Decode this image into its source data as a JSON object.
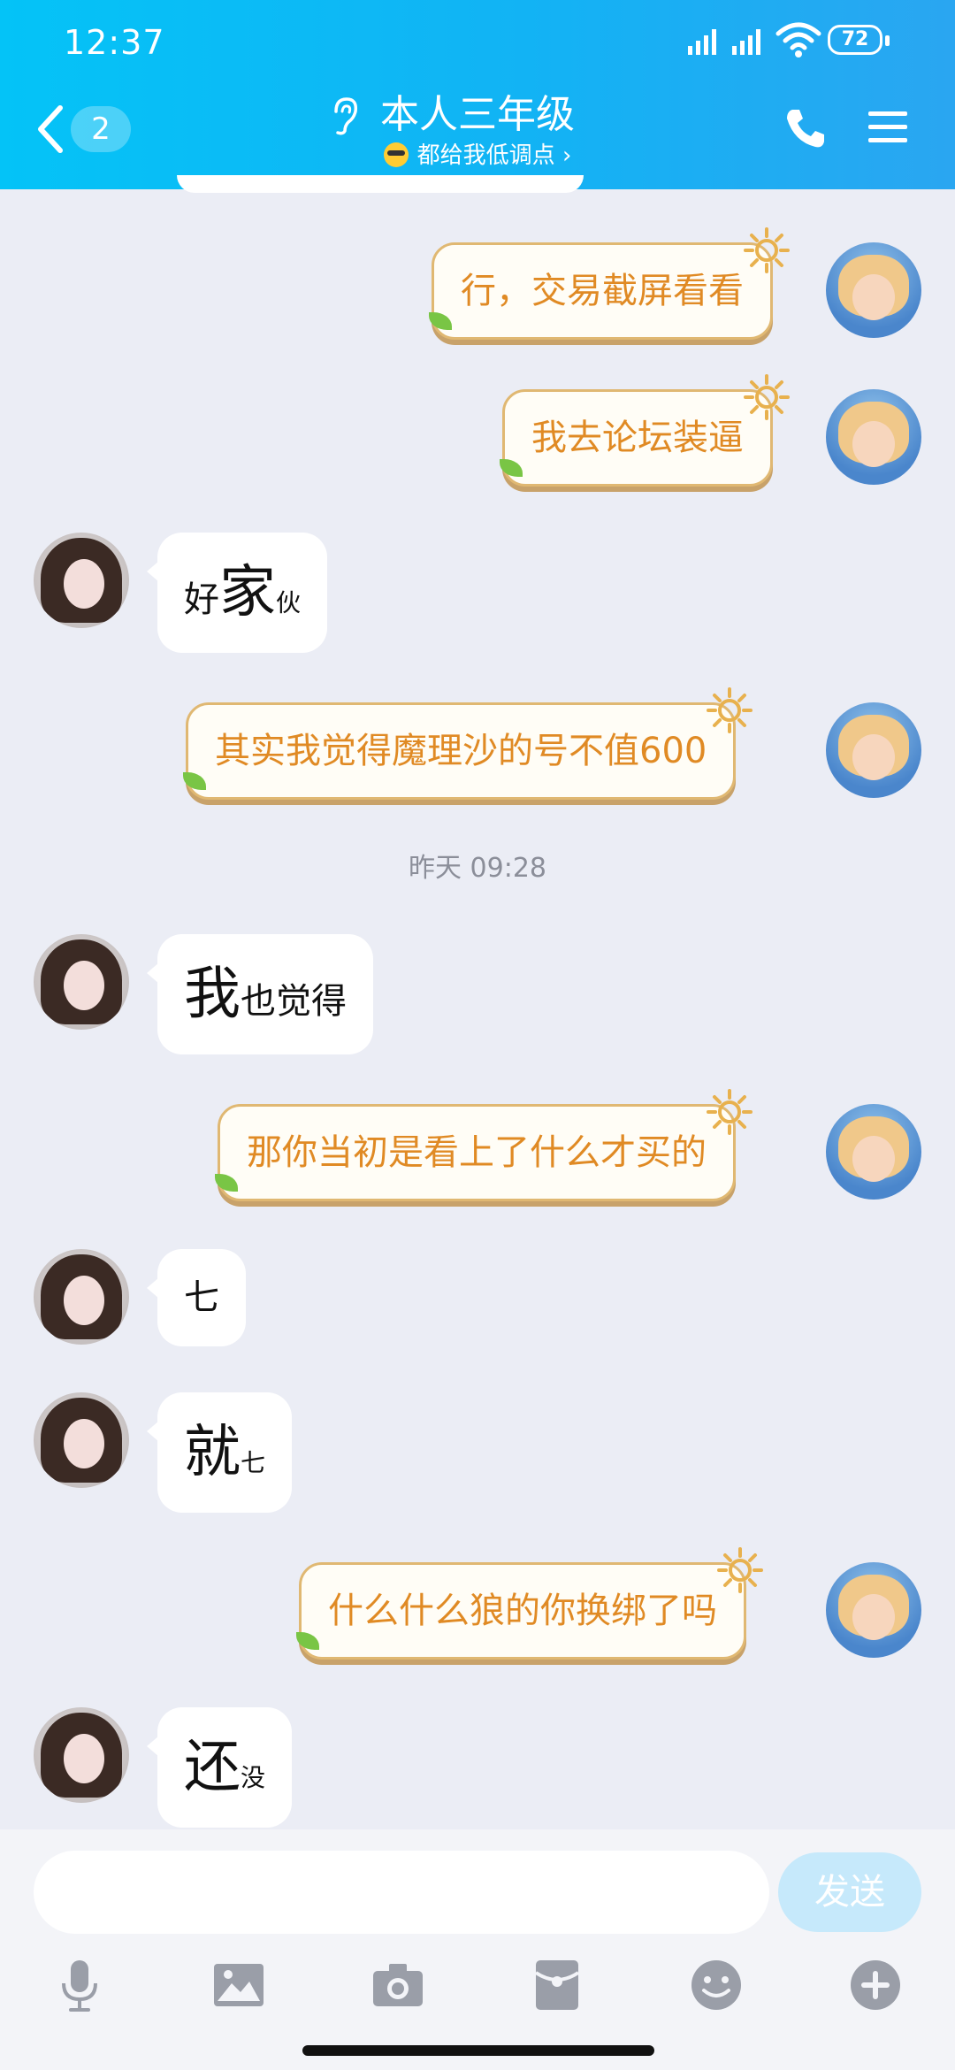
{
  "status_bar": {
    "time": "12:37",
    "battery": "72",
    "icons": [
      "signal-icon",
      "signal-icon",
      "wifi-icon",
      "battery-icon"
    ]
  },
  "header": {
    "unread_count": "2",
    "title": "本人三年级",
    "subtitle": "都给我低调点",
    "subtitle_chevron": "›",
    "icons": [
      "back-arrow-icon",
      "ear-icon",
      "sunglasses-emoji-icon",
      "phone-icon",
      "menu-icon"
    ]
  },
  "messages": [
    {
      "side": "self",
      "text": "行，交易截屏看看"
    },
    {
      "side": "self",
      "text": "我去论坛装逼"
    },
    {
      "side": "other",
      "parts": [
        "好",
        "家",
        "伙"
      ]
    },
    {
      "side": "self",
      "text": "其实我觉得魔理沙的号不值600"
    },
    {
      "side": "other",
      "parts": [
        "我",
        "也觉得"
      ]
    },
    {
      "side": "self",
      "text": "那你当初是看上了什么才买的"
    },
    {
      "side": "other",
      "parts": [
        "七"
      ]
    },
    {
      "side": "other",
      "parts": [
        "就",
        "七"
      ]
    },
    {
      "side": "self",
      "text": "什么什么狼的你换绑了吗"
    },
    {
      "side": "other",
      "parts": [
        "还",
        "没"
      ]
    }
  ],
  "timestamp": "昨天 09:28",
  "composer": {
    "input_placeholder": "",
    "send_label": "发送",
    "send_color": "#c6e9fb",
    "toolbar_icons": [
      "microphone-icon",
      "image-icon",
      "camera-icon",
      "red-packet-icon",
      "emoji-icon",
      "plus-icon"
    ]
  },
  "colors": {
    "header_start": "#04c3f7",
    "header_end": "#2aa6f1",
    "background": "#ebedf5",
    "self_bubble_text": "#e08a24",
    "self_bubble_border": "#e0b872",
    "other_bubble": "#ffffff"
  }
}
